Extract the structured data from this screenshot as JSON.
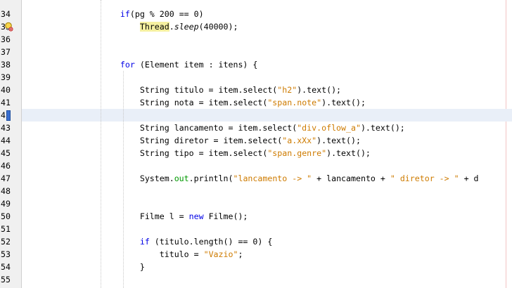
{
  "editor": {
    "current_line": "42",
    "lines": [
      {
        "num": "34",
        "tokens": [
          {
            "t": "    "
          },
          {
            "t": "if",
            "c": "kw"
          },
          {
            "t": "(pg % 200 == 0)"
          }
        ]
      },
      {
        "num": "35",
        "hint": true,
        "tokens": [
          {
            "t": "        "
          },
          {
            "t": "Thread",
            "c": "hl"
          },
          {
            "t": "."
          },
          {
            "t": "sleep",
            "c": "ital"
          },
          {
            "t": "(40000);"
          }
        ]
      },
      {
        "num": "36",
        "tokens": []
      },
      {
        "num": "37",
        "tokens": []
      },
      {
        "num": "38",
        "tokens": [
          {
            "t": "    "
          },
          {
            "t": "for",
            "c": "kw"
          },
          {
            "t": " (Element item : itens) {"
          }
        ]
      },
      {
        "num": "39",
        "tokens": []
      },
      {
        "num": "40",
        "tokens": [
          {
            "t": "        String titulo = item.select("
          },
          {
            "t": "\"h2\"",
            "c": "str"
          },
          {
            "t": ").text();"
          }
        ]
      },
      {
        "num": "41",
        "tokens": [
          {
            "t": "        String nota = item.select("
          },
          {
            "t": "\"span.note\"",
            "c": "str"
          },
          {
            "t": ").text();"
          }
        ]
      },
      {
        "num": "42",
        "current": true,
        "tokens": []
      },
      {
        "num": "43",
        "tokens": [
          {
            "t": "        String lancamento = item.select("
          },
          {
            "t": "\"div.oflow_a\"",
            "c": "str"
          },
          {
            "t": ").text();"
          }
        ]
      },
      {
        "num": "44",
        "tokens": [
          {
            "t": "        String diretor = item.select("
          },
          {
            "t": "\"a.xXx\"",
            "c": "str"
          },
          {
            "t": ").text();"
          }
        ]
      },
      {
        "num": "45",
        "tokens": [
          {
            "t": "        String tipo = item.select("
          },
          {
            "t": "\"span.genre\"",
            "c": "str"
          },
          {
            "t": ").text();"
          }
        ]
      },
      {
        "num": "46",
        "tokens": []
      },
      {
        "num": "47",
        "tokens": [
          {
            "t": "        System."
          },
          {
            "t": "out",
            "c": "fld"
          },
          {
            "t": ".println("
          },
          {
            "t": "\"lancamento -> \"",
            "c": "str"
          },
          {
            "t": " + lancamento + "
          },
          {
            "t": "\" diretor -> \"",
            "c": "str"
          },
          {
            "t": " + d"
          }
        ]
      },
      {
        "num": "48",
        "tokens": []
      },
      {
        "num": "49",
        "tokens": []
      },
      {
        "num": "50",
        "tokens": [
          {
            "t": "        Filme l = "
          },
          {
            "t": "new",
            "c": "kw"
          },
          {
            "t": " Filme();"
          }
        ]
      },
      {
        "num": "51",
        "tokens": []
      },
      {
        "num": "52",
        "tokens": [
          {
            "t": "        "
          },
          {
            "t": "if",
            "c": "kw"
          },
          {
            "t": " (titulo.length() == 0) {"
          }
        ]
      },
      {
        "num": "53",
        "tokens": [
          {
            "t": "            titulo = "
          },
          {
            "t": "\"Vazio\"",
            "c": "str"
          },
          {
            "t": ";"
          }
        ]
      },
      {
        "num": "54",
        "tokens": [
          {
            "t": "        }"
          }
        ]
      },
      {
        "num": "55",
        "tokens": []
      }
    ]
  }
}
